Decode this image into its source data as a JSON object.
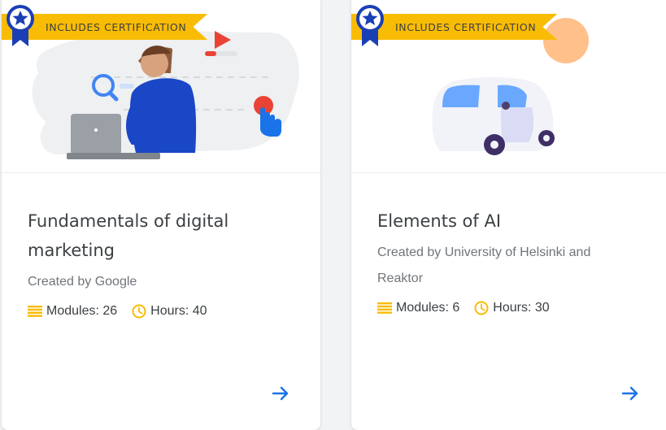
{
  "colors": {
    "badge": "#f9bc05",
    "meta_icon": "#f9bc05",
    "arrow": "#1a73e8",
    "title": "#3c4043",
    "creator": "#70757a"
  },
  "cards": [
    {
      "badge_label": "INCLUDES CERTIFICATION",
      "title": "Fundamentals of digital marketing",
      "creator": "Created by Google",
      "modules_label": "Modules: 26",
      "hours_label": "Hours: 40",
      "illustration": "person-with-laptop-illustration",
      "arrow_icon": "arrow-right-icon"
    },
    {
      "badge_label": "INCLUDES CERTIFICATION",
      "title": "Elements of AI",
      "creator": "Created by University of Helsinki and Reaktor",
      "modules_label": "Modules: 6",
      "hours_label": "Hours: 30",
      "illustration": "self-driving-car-illustration",
      "arrow_icon": "arrow-right-icon"
    }
  ]
}
